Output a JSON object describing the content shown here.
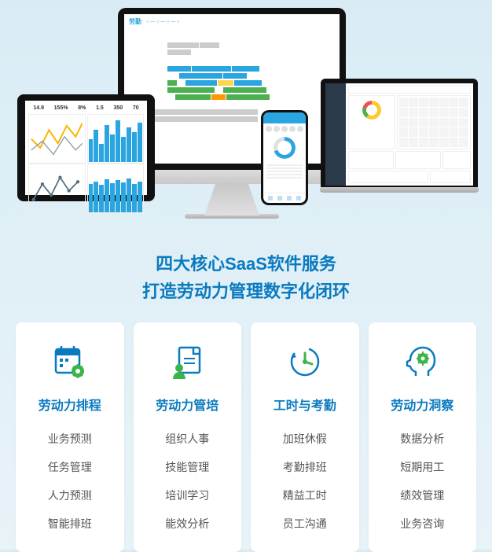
{
  "dashboard": {
    "logo": "劳勤",
    "kpis": [
      {
        "v": "14.9",
        "u": ""
      },
      {
        "v": "155%",
        "u": ""
      },
      {
        "v": "8%",
        "u": ""
      },
      {
        "v": "1.5",
        "u": ""
      },
      {
        "v": "350",
        "u": ""
      },
      {
        "v": "70",
        "u": ""
      }
    ]
  },
  "headline": {
    "line1": "四大核心SaaS软件服务",
    "line2": "打造劳动力管理数字化闭环"
  },
  "cards": [
    {
      "title": "劳动力排程",
      "items": [
        "业务预测",
        "任务管理",
        "人力预测",
        "智能排班"
      ]
    },
    {
      "title": "劳动力管培",
      "items": [
        "组织人事",
        "技能管理",
        "培训学习",
        "能效分析"
      ]
    },
    {
      "title": "工时与考勤",
      "items": [
        "加班休假",
        "考勤排班",
        "精益工时",
        "员工沟通"
      ]
    },
    {
      "title": "劳动力洞察",
      "items": [
        "数据分析",
        "短期用工",
        "绩效管理",
        "业务咨询"
      ]
    }
  ]
}
